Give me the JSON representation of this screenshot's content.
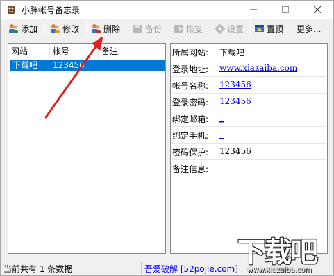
{
  "window": {
    "title": "小胖帐号备忘录",
    "controls": {
      "minimize": "—",
      "maximize": "☐",
      "close": "✕"
    }
  },
  "toolbar": {
    "buttons": [
      {
        "label": "添加",
        "icon": "users-add-icon",
        "enabled": true
      },
      {
        "label": "修改",
        "icon": "users-edit-icon",
        "enabled": true
      },
      {
        "label": "删除",
        "icon": "users-delete-icon",
        "enabled": true
      },
      {
        "label": "备份",
        "icon": "backup-icon",
        "enabled": false
      },
      {
        "label": "恢复",
        "icon": "restore-icon",
        "enabled": false
      },
      {
        "label": "设置",
        "icon": "gear-icon",
        "enabled": false
      },
      {
        "label": "置顶",
        "icon": "pin-icon",
        "enabled": true
      },
      {
        "label": "更多...",
        "icon": "",
        "enabled": true
      }
    ]
  },
  "list": {
    "columns": [
      "网站",
      "帐号",
      "备注"
    ],
    "rows": [
      {
        "site": "下载吧",
        "account": "123456",
        "note": ""
      }
    ]
  },
  "detail": {
    "rows": [
      {
        "label": "所属网站:",
        "value": "下载吧",
        "link": false
      },
      {
        "label": "登录地址:",
        "value": "www.xiazaiba.com",
        "link": true
      },
      {
        "label": "帐号名称:",
        "value": "123456",
        "link": true
      },
      {
        "label": "登录密码:",
        "value": "123456",
        "link": true
      },
      {
        "label": "绑定邮箱:",
        "value": "_",
        "link": true
      },
      {
        "label": "绑定手机:",
        "value": "_",
        "link": true
      },
      {
        "label": "密码保护:",
        "value": "123456",
        "link": false
      },
      {
        "label": "备注信息:",
        "value": "",
        "link": false
      }
    ]
  },
  "status": {
    "count_text": "当前共有 1 条数据",
    "link_text": "吾爱破解 [52pojie.com]"
  },
  "watermark": {
    "brand": "下载吧",
    "url": "www.xiazaiba.com"
  },
  "colors": {
    "selection": "#0078d7",
    "link": "#0000ee",
    "arrow": "#e02020"
  }
}
